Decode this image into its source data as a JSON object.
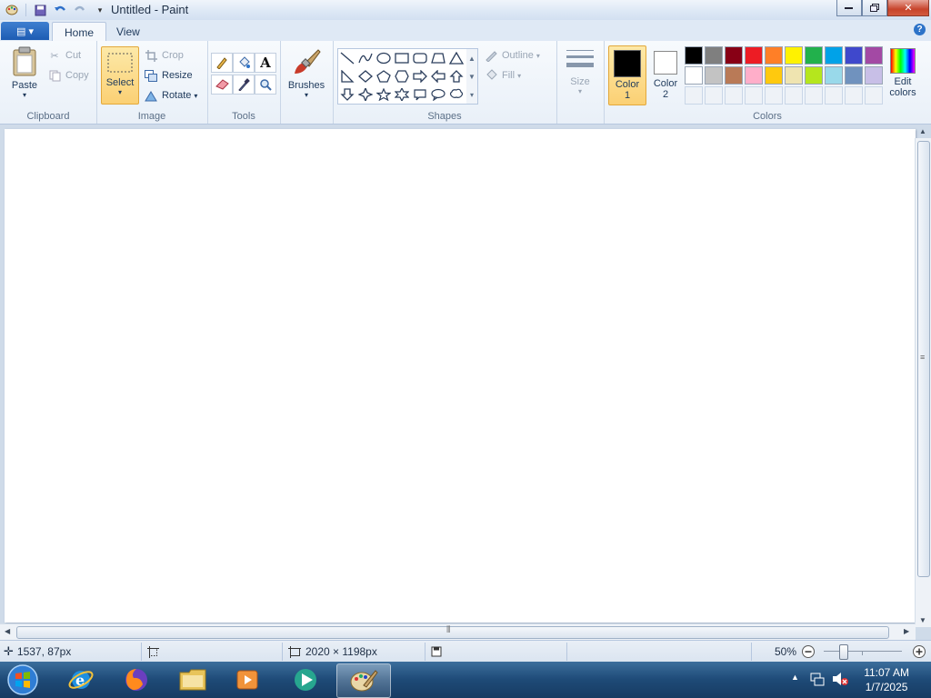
{
  "window": {
    "title": "Untitled - Paint"
  },
  "tabs": [
    {
      "label": "Home"
    },
    {
      "label": "View"
    }
  ],
  "clipboard": {
    "paste": "Paste",
    "cut": "Cut",
    "copy": "Copy",
    "group": "Clipboard"
  },
  "image": {
    "select": "Select",
    "crop": "Crop",
    "resize": "Resize",
    "rotate": "Rotate",
    "group": "Image"
  },
  "tools": {
    "group": "Tools",
    "text_glyph": "A"
  },
  "brushes": {
    "label": "Brushes"
  },
  "shapes": {
    "group": "Shapes",
    "outline": "Outline",
    "fill": "Fill"
  },
  "size": {
    "label": "Size"
  },
  "colors": {
    "color1_label": "Color",
    "color1_num": "1",
    "color2_label": "Color",
    "color2_num": "2",
    "edit_label": "Edit",
    "edit_label2": "colors",
    "group": "Colors",
    "color1_value": "#000000",
    "color2_value": "#ffffff",
    "palette_row1": [
      "#000000",
      "#7f7f7f",
      "#880015",
      "#ed1c24",
      "#ff7f27",
      "#fff200",
      "#22b14c",
      "#00a2e8",
      "#3f48cc",
      "#a349a4"
    ],
    "palette_row2": [
      "#ffffff",
      "#c3c3c3",
      "#b97a57",
      "#ffaec9",
      "#ffc90e",
      "#efe4b0",
      "#b5e61d",
      "#99d9ea",
      "#7092be",
      "#c8bfe7"
    ]
  },
  "status": {
    "cursor_pos": "1537, 87px",
    "image_size": "2020 × 1198px",
    "zoom": "50%"
  },
  "taskbar": {
    "time": "11:07 AM",
    "date": "1/7/2025"
  }
}
